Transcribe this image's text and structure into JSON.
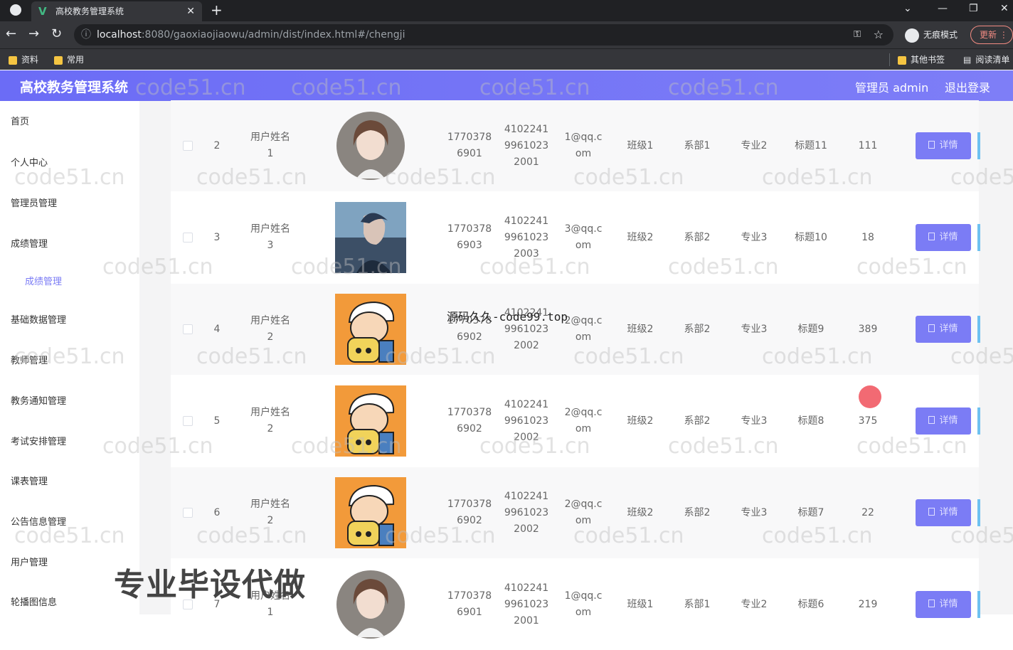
{
  "browser": {
    "tab_title": "高校教务管理系统",
    "url_host": "localhost",
    "url_rest": ":8080/gaoxiaojiaowu/admin/dist/index.html#/chengji",
    "incognito_label": "无痕模式",
    "update_label": "更新",
    "bookmarks": [
      "资料",
      "常用"
    ],
    "bookmarks_right": [
      "其他书签",
      "阅读清单"
    ]
  },
  "header": {
    "title": "高校教务管理系统",
    "admin_label": "管理员 admin",
    "logout_label": "退出登录"
  },
  "sidebar": {
    "items": [
      "首页",
      "个人中心",
      "管理员管理",
      "成绩管理",
      "基础数据管理",
      "教师管理",
      "教务通知管理",
      "考试安排管理",
      "课表管理",
      "公告信息管理",
      "用户管理",
      "轮播图信息"
    ],
    "sub_item": "成绩管理"
  },
  "table": {
    "detail_label": "详情",
    "rows": [
      {
        "index": "2",
        "name_l1": "用户姓名",
        "name_l2": "1",
        "phone_l1": "1770378",
        "phone_l2": "6901",
        "id_l1": "4102241",
        "id_l2": "9961023",
        "id_l3": "2001",
        "email_l1": "1@qq.c",
        "email_l2": "om",
        "class": "班级1",
        "dept": "系部1",
        "major": "专业2",
        "title": "标题11",
        "score": "111",
        "avatar": "girl"
      },
      {
        "index": "3",
        "name_l1": "用户姓名",
        "name_l2": "3",
        "phone_l1": "1770378",
        "phone_l2": "6903",
        "id_l1": "4102241",
        "id_l2": "9961023",
        "id_l3": "2003",
        "email_l1": "3@qq.c",
        "email_l2": "om",
        "class": "班级2",
        "dept": "系部2",
        "major": "专业3",
        "title": "标题10",
        "score": "18",
        "avatar": "boy"
      },
      {
        "index": "4",
        "name_l1": "用户姓名",
        "name_l2": "2",
        "phone_l1": "1770378",
        "phone_l2": "6902",
        "id_l1": "4102241",
        "id_l2": "9961023",
        "id_l3": "2002",
        "email_l1": "2@qq.c",
        "email_l2": "om",
        "class": "班级2",
        "dept": "系部2",
        "major": "专业3",
        "title": "标题9",
        "score": "389",
        "avatar": "cartoon"
      },
      {
        "index": "5",
        "name_l1": "用户姓名",
        "name_l2": "2",
        "phone_l1": "1770378",
        "phone_l2": "6902",
        "id_l1": "4102241",
        "id_l2": "9961023",
        "id_l3": "2002",
        "email_l1": "2@qq.c",
        "email_l2": "om",
        "class": "班级2",
        "dept": "系部2",
        "major": "专业3",
        "title": "标题8",
        "score": "375",
        "avatar": "cartoon"
      },
      {
        "index": "6",
        "name_l1": "用户姓名",
        "name_l2": "2",
        "phone_l1": "1770378",
        "phone_l2": "6902",
        "id_l1": "4102241",
        "id_l2": "9961023",
        "id_l3": "2002",
        "email_l1": "2@qq.c",
        "email_l2": "om",
        "class": "班级2",
        "dept": "系部2",
        "major": "专业3",
        "title": "标题7",
        "score": "22",
        "avatar": "cartoon"
      },
      {
        "index": "7",
        "name_l1": "用户姓名",
        "name_l2": "1",
        "phone_l1": "1770378",
        "phone_l2": "6901",
        "id_l1": "4102241",
        "id_l2": "9961023",
        "id_l3": "2001",
        "email_l1": "1@qq.c",
        "email_l2": "om",
        "class": "班级1",
        "dept": "系部1",
        "major": "专业2",
        "title": "标题6",
        "score": "219",
        "avatar": "girl"
      }
    ]
  },
  "overlay": {
    "source_tag": "源码久久-code99.top",
    "promo_text": "专业毕设代做",
    "watermark": "code51.cn"
  },
  "colors": {
    "accent": "#7b7cf5",
    "header_bg": "#6b6cf6"
  }
}
